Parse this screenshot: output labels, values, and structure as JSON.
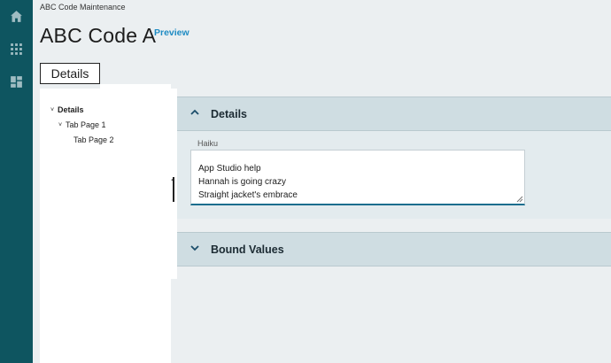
{
  "nav": {
    "icons": [
      "home-icon",
      "apps-grid-icon",
      "dashboard-icon"
    ]
  },
  "breadcrumb": "ABC Code Maintenance",
  "page": {
    "title": "ABC Code A",
    "preview_label": "Preview"
  },
  "tab": {
    "label": "Details"
  },
  "tree": {
    "items": [
      {
        "label": "Details",
        "expanded": true
      },
      {
        "label": "Tab Page 1",
        "expanded": true
      },
      {
        "label": "Tab Page 2"
      }
    ]
  },
  "sections": {
    "details": {
      "title": "Details",
      "expanded": true,
      "field_label": "Haiku",
      "haiku_lines": [
        "App Studio help",
        "Hannah is going crazy",
        "Straight jacket's embrace"
      ]
    },
    "bound_values": {
      "title": "Bound Values",
      "expanded": false
    }
  },
  "colors": {
    "rail": "#0e5560",
    "accent": "#1e8bc3",
    "section_header": "#cfdde2",
    "page_bg": "#ebeff1"
  }
}
